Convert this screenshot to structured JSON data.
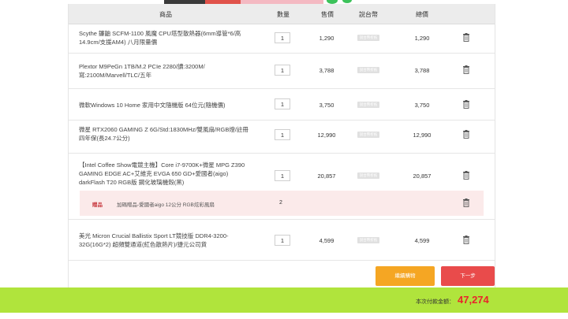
{
  "header": {
    "product": "商品",
    "quantity": "數量",
    "price": "售價",
    "tag": "說台幣",
    "subtotal": "總價"
  },
  "items": [
    {
      "name": "Scythe 鐮鼬 SCFM-1100 風魔 CPU塔型散熱器(6mm導管*6/高14.9cm/支援AM4) 八月限量價",
      "qty": "1",
      "price": "1,290",
      "tag": "說台幣折抵",
      "subtotal": "1,290"
    },
    {
      "name": "Plextor M9PeGn 1TB/M.2 PCIe 2280/讀:3200M/寫:2100M/Marvell/TLC/五年",
      "qty": "1",
      "price": "3,788",
      "tag": "說台幣折抵",
      "subtotal": "3,788"
    },
    {
      "name": "微軟Windows 10 Home 家用中文隨機版 64位元(隨機價)",
      "qty": "1",
      "price": "3,750",
      "tag": "說台幣折抵",
      "subtotal": "3,750"
    },
    {
      "name": "微星 RTX2060 GAMING Z 6G/Std:1830MHz/雙風扇/RGB燈/註冊四年保(長24.7公分)",
      "qty": "1",
      "price": "12,990",
      "tag": "說台幣折抵",
      "subtotal": "12,990"
    },
    {
      "name": "【Intel Coffee Show電競主機】Core i7-9700K+微星 MPG Z390 GAMING EDGE AC+艾維克 EVGA 650 GD+愛國者(aigo) darkFlash T20 RGB版 鋼化玻璃機殼(黑)",
      "qty": "1",
      "price": "20,857",
      "tag": "說台幣折抵",
      "subtotal": "20,857"
    },
    {
      "name": "美光 Micron Crucial Ballistix Sport LT競技版 DDR4-3200-32G(16G*2) 超頻雙通道(紅色散熱片)/捷元公司貨",
      "qty": "1",
      "price": "4,599",
      "tag": "說台幣折抵",
      "subtotal": "4,599"
    }
  ],
  "gift": {
    "label": "贈品",
    "name": "加碼贈品-愛國者aigo 12公分 RGB炫彩風扇",
    "qty": "2"
  },
  "actions": {
    "continue_label": "繼續購物",
    "next_label": "下一步"
  },
  "summary": {
    "total_label": "本次付款金額：",
    "total_value": "47,274"
  },
  "colors": {
    "continue_button": "#f5a623",
    "next_button": "#e94b4b",
    "footer_background": "#b0e43c",
    "total_value": "#e8252b",
    "gift_background": "#fbeaea"
  },
  "icons": [
    "trash-icon"
  ]
}
